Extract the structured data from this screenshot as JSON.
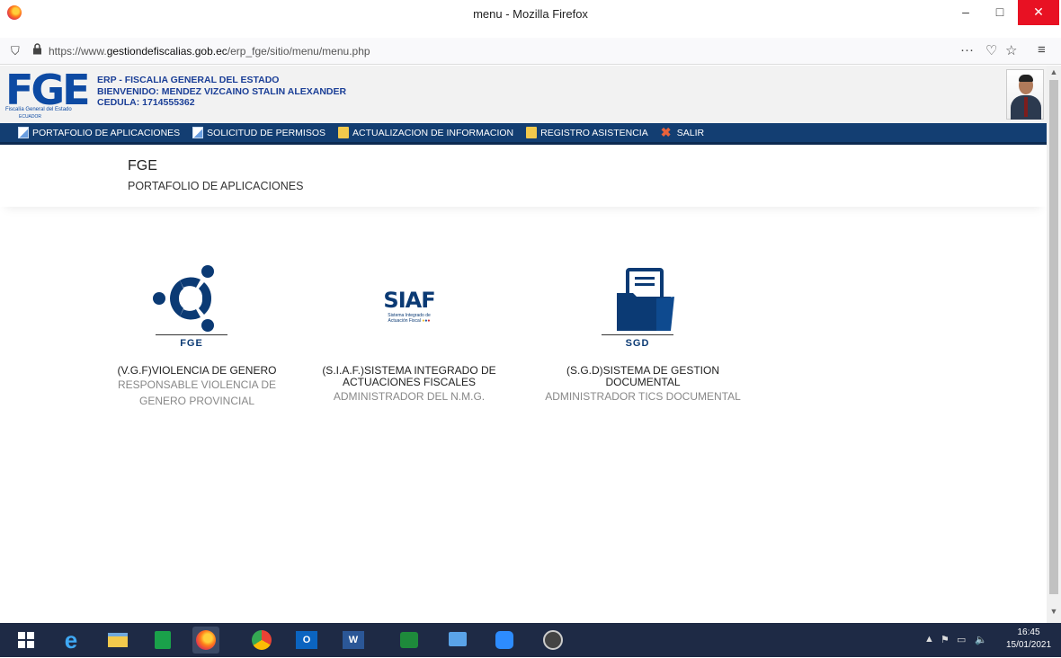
{
  "window": {
    "title": "menu - Mozilla Firefox",
    "minimize": "–",
    "maximize": "□",
    "close": "✕"
  },
  "urlbar": {
    "url_prefix": "https://www.",
    "url_domain": "gestiondefiscalias.gob.ec",
    "url_path": "/erp_fge/sitio/menu/menu.php",
    "more": "···",
    "pocket": "♡",
    "star": "☆",
    "menu": "≡"
  },
  "header": {
    "logo_text": "FGE",
    "logo_sub": "Fiscalía General del Estado",
    "logo_country": "ECUADOR",
    "line1": "ERP - FISCALIA GENERAL DEL ESTADO",
    "line2": "BIENVENIDO: MENDEZ VIZCAINO STALIN ALEXANDER",
    "line3": "CEDULA: 1714555362"
  },
  "nav": [
    {
      "label": "PORTAFOLIO DE APLICACIONES",
      "icon": "doc"
    },
    {
      "label": "SOLICITUD DE PERMISOS",
      "icon": "doc"
    },
    {
      "label": "ACTUALIZACION DE INFORMACION",
      "icon": "folder"
    },
    {
      "label": "REGISTRO ASISTENCIA",
      "icon": "folder"
    },
    {
      "label": "SALIR",
      "icon": "x"
    }
  ],
  "page": {
    "title": "FGE",
    "subtitle": "PORTAFOLIO DE APLICACIONES"
  },
  "apps": [
    {
      "caption": "FGE",
      "name": "(V.G.F)VIOLENCIA DE GENERO",
      "role": "RESPONSABLE VIOLENCIA DE GENERO PROVINCIAL",
      "color": "#0b3a74"
    },
    {
      "caption": "",
      "logo": "SIAF",
      "logo_sub1": "Sistema Integrado de",
      "logo_sub2": "Actuación Fiscal",
      "name": "(S.I.A.F.)SISTEMA INTEGRADO DE ACTUACIONES FISCALES",
      "role": "ADMINISTRADOR DEL N.M.G.",
      "color": "#0b3a74"
    },
    {
      "caption": "SGD",
      "name": "(S.G.D)SISTEMA DE GESTION DOCUMENTAL",
      "role": "ADMINISTRADOR TICS DOCUMENTAL",
      "color": "#0b3a74"
    }
  ],
  "taskbar": {
    "time": "16:45",
    "date": "15/01/2021"
  }
}
